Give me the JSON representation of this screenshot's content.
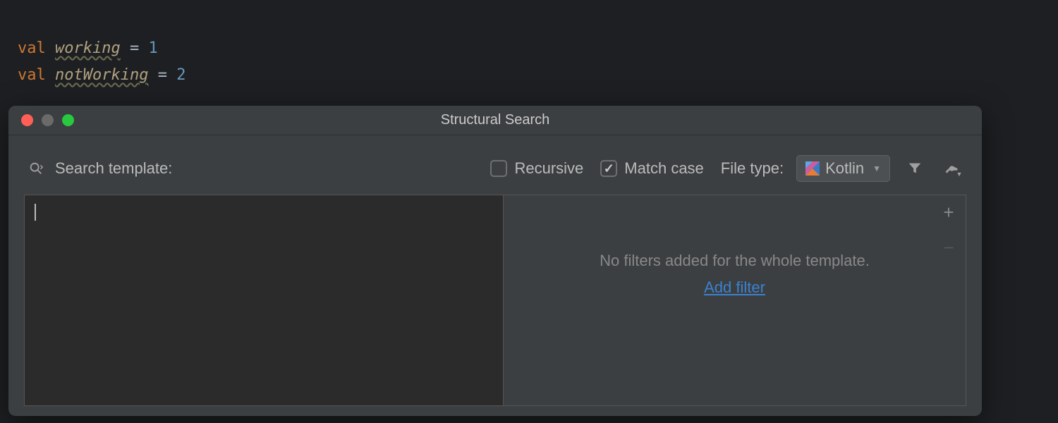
{
  "code": {
    "lines": [
      {
        "keyword": "val",
        "name": "working",
        "op": "=",
        "value": "1"
      },
      {
        "keyword": "val",
        "name": "notWorking",
        "op": "=",
        "value": "2"
      }
    ]
  },
  "dialog": {
    "title": "Structural Search",
    "search_label": "Search template:",
    "recursive": {
      "label": "Recursive",
      "checked": false
    },
    "match_case": {
      "label": "Match case",
      "checked": true
    },
    "filetype_label": "File type:",
    "filetype_value": "Kotlin",
    "template_text": "",
    "filters_empty_text": "No filters added for the whole template.",
    "add_filter_label": "Add filter",
    "add_button": "+",
    "remove_button": "−"
  }
}
